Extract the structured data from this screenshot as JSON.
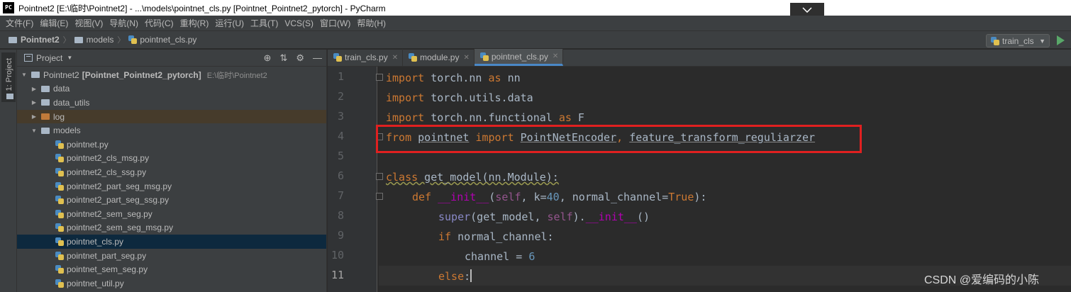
{
  "window": {
    "app_icon": "PC",
    "title": "Pointnet2 [E:\\临时\\Pointnet2] - ...\\models\\pointnet_cls.py [Pointnet_Pointnet2_pytorch] - PyCharm"
  },
  "menu": [
    "文件(F)",
    "编辑(E)",
    "视图(V)",
    "导航(N)",
    "代码(C)",
    "重构(R)",
    "运行(U)",
    "工具(T)",
    "VCS(S)",
    "窗口(W)",
    "帮助(H)"
  ],
  "breadcrumb": {
    "root": "Pointnet2",
    "folder": "models",
    "file": "pointnet_cls.py"
  },
  "run_config": {
    "label": "train_cls"
  },
  "stripe": {
    "label": "1: Project"
  },
  "project_panel": {
    "title": "Project",
    "root": {
      "name": "Pointnet2",
      "module": "[Pointnet_Pointnet2_pytorch]",
      "path": "E:\\临时\\Pointnet2"
    },
    "folders": [
      "data",
      "data_utils",
      "log",
      "models"
    ],
    "files": [
      "pointnet.py",
      "pointnet2_cls_msg.py",
      "pointnet2_cls_ssg.py",
      "pointnet2_part_seg_msg.py",
      "pointnet2_part_seg_ssg.py",
      "pointnet2_sem_seg.py",
      "pointnet2_sem_seg_msg.py",
      "pointnet_cls.py",
      "pointnet_part_seg.py",
      "pointnet_sem_seg.py",
      "pointnet_util.py"
    ],
    "selected_file": "pointnet_cls.py"
  },
  "tabs": [
    {
      "label": "train_cls.py",
      "active": false
    },
    {
      "label": "module.py",
      "active": false
    },
    {
      "label": "pointnet_cls.py",
      "active": true
    }
  ],
  "line_numbers": [
    "1",
    "2",
    "3",
    "4",
    "5",
    "6",
    "7",
    "8",
    "9",
    "10",
    "11"
  ],
  "code": {
    "l1": {
      "kw1": "import",
      "mid": " torch.nn ",
      "kw2": "as",
      "end": " nn"
    },
    "l2": {
      "kw1": "import",
      "end": " torch.utils.data"
    },
    "l3": {
      "kw1": "import",
      "mid": " torch.nn.functional ",
      "kw2": "as",
      "end": " F"
    },
    "l4": {
      "kw1": "from",
      "mod": "pointnet",
      "kw2": "import",
      "n1": "PointNetEncoder",
      "comma": ", ",
      "n2": "feature_transform_reguliarzer"
    },
    "l6": {
      "kw": "class",
      "rest": " get_model(nn.Module):"
    },
    "l7": {
      "kw": "def",
      "fn": "__init__",
      "p1": "(",
      "self": "self",
      "p2": ", k=",
      "num": "40",
      "p3": ", normal_channel=",
      "tru": "True",
      "p4": "):"
    },
    "l8": {
      "sup": "super",
      "p1": "(get_model, ",
      "self": "self",
      "p2": ").",
      "fn": "__init__",
      "p3": "()"
    },
    "l9": {
      "kw": "if",
      "rest": " normal_channel:"
    },
    "l10": {
      "var": "channel = ",
      "num": "6"
    },
    "l11": {
      "kw": "else",
      "rest": ":"
    }
  },
  "watermark": "CSDN @爱编码的小陈"
}
